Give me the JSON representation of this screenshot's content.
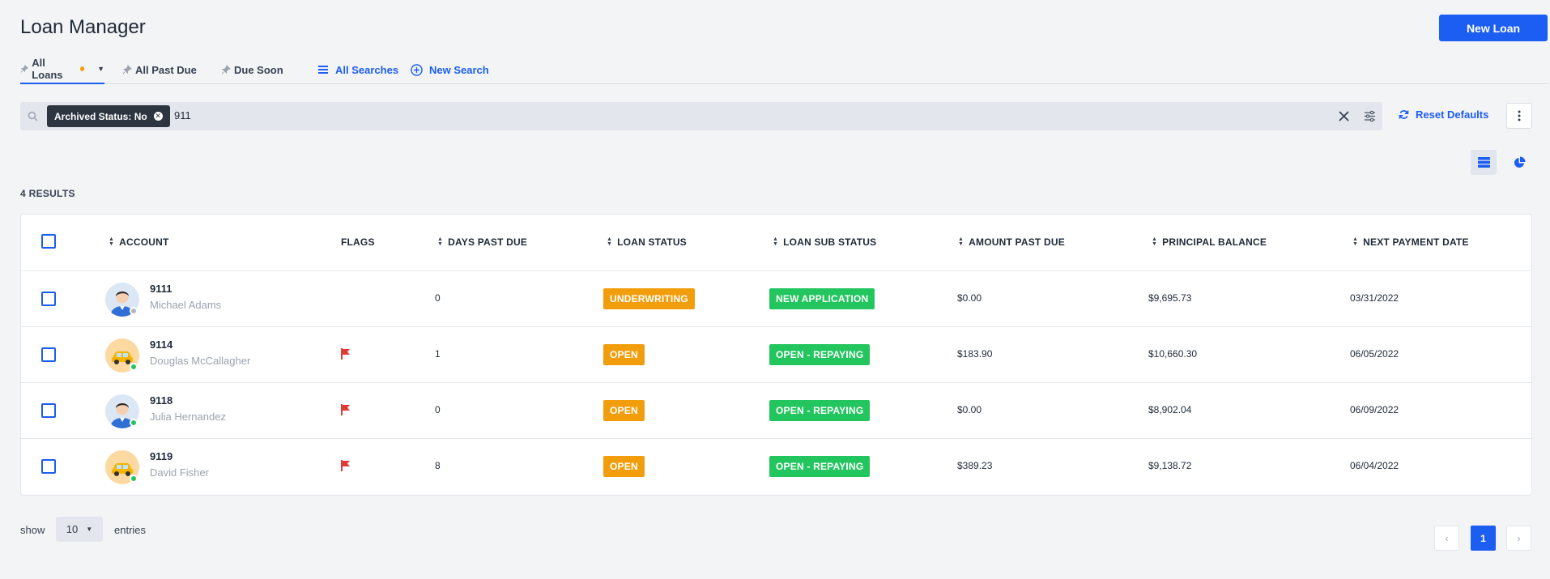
{
  "header": {
    "title": "Loan Manager",
    "new_loan_label": "New Loan"
  },
  "tabs": [
    {
      "label": "All Loans",
      "active": true,
      "has_dot": true
    },
    {
      "label": "All Past Due"
    },
    {
      "label": "Due Soon"
    }
  ],
  "links": {
    "all_searches": "All Searches",
    "new_search": "New Search",
    "reset_defaults": "Reset Defaults"
  },
  "search": {
    "chip_label": "Archived Status: No",
    "query": "911"
  },
  "results_label": "4 RESULTS",
  "table": {
    "columns": [
      "ACCOUNT",
      "FLAGS",
      "DAYS PAST DUE",
      "LOAN STATUS",
      "LOAN SUB STATUS",
      "AMOUNT PAST DUE",
      "PRINCIPAL BALANCE",
      "NEXT PAYMENT DATE"
    ],
    "rows": [
      {
        "account": "9111",
        "name": "Michael Adams",
        "avatar": "person-avatar",
        "presence": "offline",
        "flag": false,
        "days_past_due": "0",
        "loan_status": "UNDERWRITING",
        "loan_sub_status": "NEW APPLICATION",
        "amount_past_due": "$0.00",
        "principal_balance": "$9,695.73",
        "next_payment_date": "03/31/2022"
      },
      {
        "account": "9114",
        "name": "Douglas McCallagher",
        "avatar": "car-avatar",
        "presence": "online",
        "flag": true,
        "days_past_due": "1",
        "loan_status": "OPEN",
        "loan_sub_status": "OPEN - REPAYING",
        "amount_past_due": "$183.90",
        "principal_balance": "$10,660.30",
        "next_payment_date": "06/05/2022"
      },
      {
        "account": "9118",
        "name": "Julia Hernandez",
        "avatar": "person-avatar",
        "presence": "online",
        "flag": true,
        "days_past_due": "0",
        "loan_status": "OPEN",
        "loan_sub_status": "OPEN - REPAYING",
        "amount_past_due": "$0.00",
        "principal_balance": "$8,902.04",
        "next_payment_date": "06/09/2022"
      },
      {
        "account": "9119",
        "name": "David Fisher",
        "avatar": "car-avatar",
        "presence": "online",
        "flag": true,
        "days_past_due": "8",
        "loan_status": "OPEN",
        "loan_sub_status": "OPEN - REPAYING",
        "amount_past_due": "$389.23",
        "principal_balance": "$9,138.72",
        "next_payment_date": "06/04/2022"
      }
    ]
  },
  "pagination": {
    "show_label": "show",
    "entries_value": "10",
    "entries_label": "entries",
    "current_page": "1",
    "prev": "‹",
    "next": "›"
  },
  "colors": {
    "accent": "#1c5df2",
    "underwriting": "#f29d0c",
    "open": "#f29d0c",
    "sub_status": "#22c55e",
    "flag": "#e53935"
  }
}
